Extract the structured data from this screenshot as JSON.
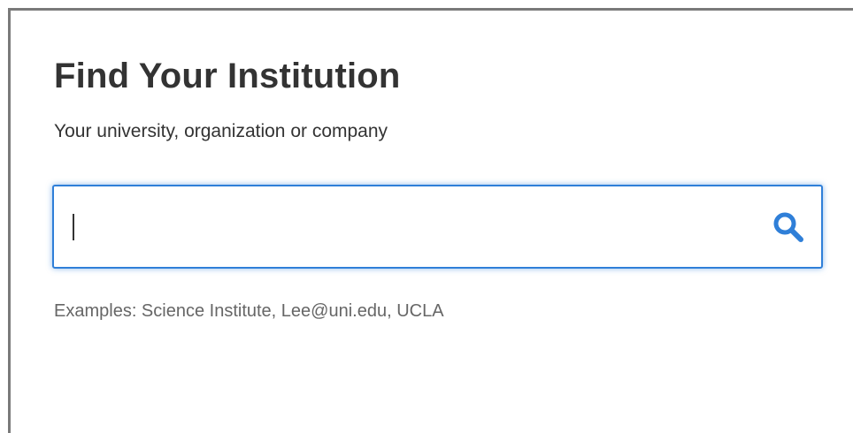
{
  "header": {
    "title": "Find Your Institution",
    "subtitle": "Your university, organization or company"
  },
  "search": {
    "value": "",
    "placeholder": "",
    "icon": "search-icon"
  },
  "hint": {
    "examples": "Examples: Science Institute, Lee@uni.edu, UCLA"
  },
  "colors": {
    "accent": "#2f7fd8",
    "title_text": "#333333",
    "hint_text": "#666666",
    "frame_border": "#7a7a7a"
  }
}
